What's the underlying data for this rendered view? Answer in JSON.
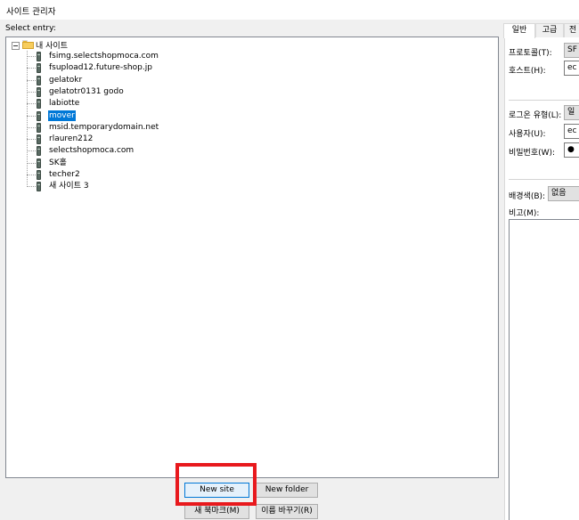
{
  "window": {
    "title": "사이트 관리자"
  },
  "tree": {
    "select_label": "Select entry:",
    "root_label": "내 사이트",
    "items": [
      {
        "label": "fsimg.selectshopmoca.com"
      },
      {
        "label": "fsupload12.future-shop.jp"
      },
      {
        "label": "gelatokr"
      },
      {
        "label": "gelatotr0131 godo"
      },
      {
        "label": "labiotte"
      },
      {
        "label": "mover",
        "selected": true
      },
      {
        "label": "msid.temporarydomain.net"
      },
      {
        "label": "rlauren212"
      },
      {
        "label": "selectshopmoca.com"
      },
      {
        "label": "SK홀"
      },
      {
        "label": "techer2"
      },
      {
        "label": "새 사이트 3"
      }
    ]
  },
  "buttons": {
    "new_site": "New site",
    "new_folder": "New folder",
    "new_bookmark": "새 북마크(M)",
    "rename": "이름 바꾸기(R)"
  },
  "right_panel": {
    "tabs": [
      "일반",
      "고급",
      "전"
    ],
    "protocol_label": "프로토콜(T):",
    "protocol_value": "SF",
    "host_label": "호스트(H):",
    "host_value": "ec",
    "logon_type_label": "로그온 유형(L):",
    "logon_type_value": "일",
    "user_label": "사용자(U):",
    "user_value": "ec",
    "password_label": "비밀번호(W):",
    "password_value": "●",
    "background_label": "배경색(B):",
    "background_value": "없음",
    "memo_label": "비고(M):"
  },
  "colors": {
    "selection": "#0078d7",
    "highlight_box": "#e8191d"
  }
}
